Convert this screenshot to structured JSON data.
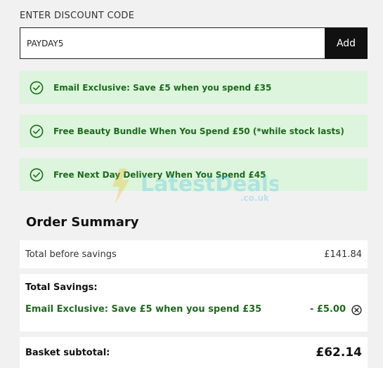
{
  "discount": {
    "title": "ENTER DISCOUNT CODE",
    "code_value": "PAYDAY5",
    "add_label": "Add"
  },
  "promotions": [
    {
      "text": "Email Exclusive: Save £5 when you spend £35",
      "icon": "check-circle-icon"
    },
    {
      "text": "Free Beauty Bundle When You Spend £50 (*while stock lasts)",
      "icon": "check-circle-icon"
    },
    {
      "text": "Free Next Day Delivery When You Spend £45",
      "icon": "check-circle-icon"
    }
  ],
  "watermark": {
    "name": "LatestDeals",
    "suffix": ".co.uk"
  },
  "summary": {
    "title": "Order Summary",
    "before_label": "Total before savings",
    "before_value": "£141.84",
    "savings_title": "Total Savings:",
    "savings_item_label": "Email Exclusive: Save £5 when you spend £35",
    "savings_item_value": "- £5.00",
    "subtotal_label": "Basket subtotal:",
    "subtotal_value": "£62.14"
  },
  "colors": {
    "promo_bg": "#dcf5dc",
    "promo_text": "#1e6a1e",
    "button_bg": "#111111",
    "page_bg": "#f1f1f1"
  }
}
